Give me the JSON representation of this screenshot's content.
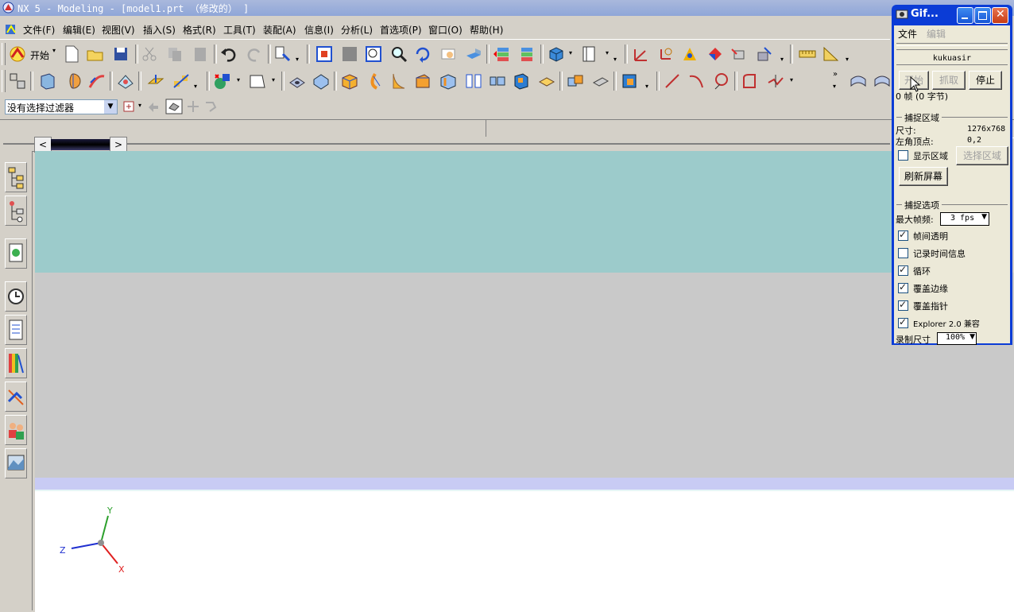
{
  "window": {
    "title": "NX 5 - Modeling - [model1.prt （修改的） ]"
  },
  "menubar": {
    "items": [
      "文件(F)",
      "编辑(E)",
      "视图(V)",
      "插入(S)",
      "格式(R)",
      "工具(T)",
      "装配(A)",
      "信息(I)",
      "分析(L)",
      "首选项(P)",
      "窗口(O)",
      "帮助(H)"
    ]
  },
  "toolbar": {
    "start_label": "开始"
  },
  "selection": {
    "filter_value": "没有选择过滤器"
  },
  "gif_window": {
    "title": "Gif...",
    "menu_file": "文件",
    "menu_edit": "编辑",
    "user_field": "kukuasir",
    "btn_start": "开始",
    "btn_capture": "抓取",
    "btn_stop": "停止",
    "frame_info": "0 帧  (0 字节)",
    "section_capture_area": "捕捉区域",
    "size_label": "尺寸:",
    "size_value": "1276x768",
    "corner_label": "左角顶点:",
    "corner_value": "0,2",
    "show_area_label": "显示区域",
    "select_area_btn": "选择区域",
    "refresh_btn": "刷新屏幕",
    "section_capture_opts": "捕捉选项",
    "max_fps_label": "最大帧频:",
    "max_fps_value": "3 fps",
    "opt_transparent": "帧间透明",
    "opt_time_info": "记录时间信息",
    "opt_loop": "循环",
    "opt_cover_edge": "覆盖边缘",
    "opt_cover_pointer": "覆盖指针",
    "opt_explorer": "Explorer 2.0 兼容",
    "record_size_label": "录制尺寸",
    "record_size_value": "100%"
  },
  "axes": {
    "x": "X",
    "y": "Y",
    "z": "Z"
  },
  "colors": {
    "titlebar": "#8fa6d8",
    "gfx_top": "#9ccbcb",
    "gfx_mid": "#c9c9c9",
    "gfx_strip": "#c8cbf4",
    "gif_frame": "#0b3cd6"
  }
}
